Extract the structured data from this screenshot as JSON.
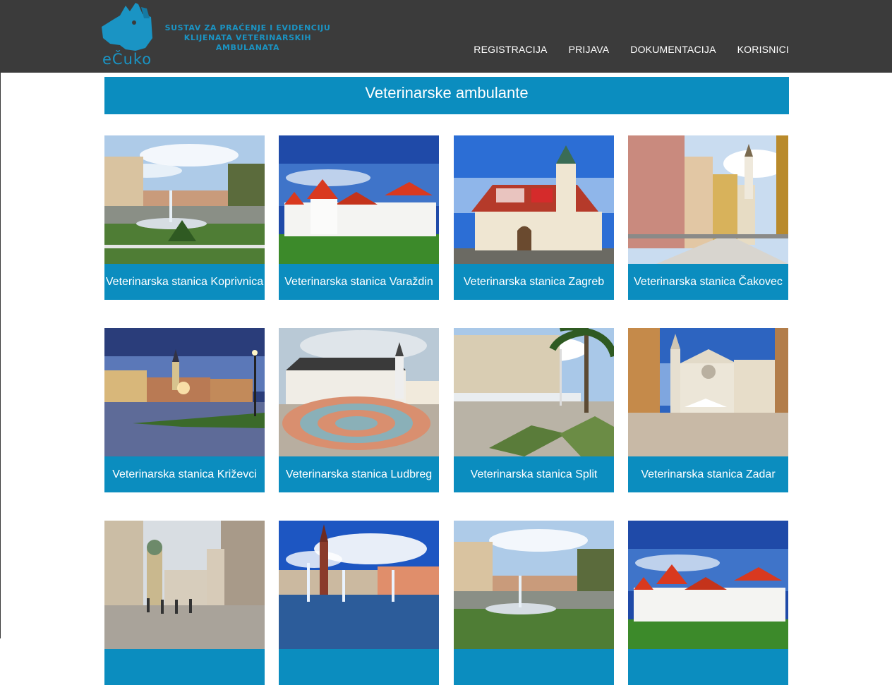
{
  "header": {
    "logo_text": "eČuko",
    "tagline_line1": "SUSTAV ZA PRAĆENJE I EVIDENCIJU",
    "tagline_line2": "KLIJENATA VETERINARSKIH AMBULANATA",
    "nav": [
      "REGISTRACIJA",
      "PRIJAVA",
      "DOKUMENTACIJA",
      "KORISNICI"
    ]
  },
  "page_title": "Veterinarske ambulante",
  "clinics": [
    {
      "label": "Veterinarska stanica Koprivnica",
      "scene": "park-fountain"
    },
    {
      "label": "Veterinarska stanica Varaždin",
      "scene": "castle"
    },
    {
      "label": "Veterinarska stanica Zagreb",
      "scene": "church-tiled-roof"
    },
    {
      "label": "Veterinarska stanica Čakovec",
      "scene": "street-tower"
    },
    {
      "label": "Veterinarska stanica Križevci",
      "scene": "night-square"
    },
    {
      "label": "Veterinarska stanica Ludbreg",
      "scene": "circle-square"
    },
    {
      "label": "Veterinarska stanica Split",
      "scene": "promenade-palms"
    },
    {
      "label": "Veterinarska stanica Zadar",
      "scene": "cathedral-street"
    },
    {
      "label": "",
      "scene": "rijeka-street"
    },
    {
      "label": "",
      "scene": "osijek-fountain"
    },
    {
      "label": "",
      "scene": "park-fountain"
    },
    {
      "label": "",
      "scene": "castle"
    }
  ],
  "colors": {
    "header_bg": "#3b3b3b",
    "accent": "#0b8dbf",
    "logo": "#1a94c4"
  }
}
